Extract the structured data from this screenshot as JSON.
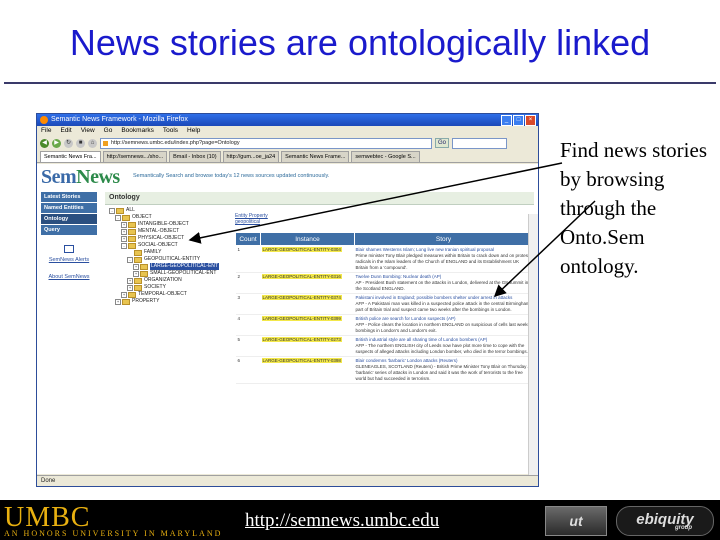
{
  "slide": {
    "title": "News stories are ontologically linked",
    "callout": "Find news stories by browsing through the Onto.Sem ontology.",
    "footer_url": "http://semnews.umbc.edu",
    "footer_logo_umbc": "UMBC",
    "footer_logo_umbc_sub": "AN HONORS UNIVERSITY IN MARYLAND",
    "footer_logo_ut": "ut",
    "footer_logo_ebiquity": "ebiquity",
    "footer_logo_ebiquity_sub": "group"
  },
  "browser": {
    "title": "Semantic News Framework - Mozilla Firefox",
    "menu": [
      "File",
      "Edit",
      "View",
      "Go",
      "Bookmarks",
      "Tools",
      "Help"
    ],
    "url": "http://semnews.umbc.edu/index.php?page=Ontology",
    "go_label": "Go",
    "search_placeholder": "",
    "tabs": [
      {
        "label": "Semantic News Fra...",
        "active": true
      },
      {
        "label": "http://semnews.../sho...",
        "active": false
      },
      {
        "label": "Bmail - Inbox (10)",
        "active": false
      },
      {
        "label": "http://gum...oe_ja24",
        "active": false
      },
      {
        "label": "Semantic News Frame...",
        "active": false
      },
      {
        "label": "semwebtec - Google S...",
        "active": false
      }
    ],
    "status": "Done"
  },
  "page": {
    "logo_prefix": "Sem",
    "logo_suffix": "News",
    "tagline": "Semantically Search and browse today's 12 news sources updated continuously.",
    "nav": [
      {
        "label": "Latest Stories",
        "selected": false
      },
      {
        "label": "Named Entities",
        "selected": false
      },
      {
        "label": "Ontology",
        "selected": true
      },
      {
        "label": "Query",
        "selected": false
      }
    ],
    "side_links": [
      "SemNews Alerts",
      "About SemNews"
    ],
    "panel_title": "Ontology",
    "tree": [
      {
        "label": "ALL",
        "indent": 0,
        "toggle": "-"
      },
      {
        "label": "OBJECT",
        "indent": 1,
        "toggle": "-"
      },
      {
        "label": "INTANGIBLE-OBJECT",
        "indent": 2,
        "toggle": "+"
      },
      {
        "label": "MENTAL-OBJECT",
        "indent": 2,
        "toggle": "+"
      },
      {
        "label": "PHYSICAL-OBJECT",
        "indent": 2,
        "toggle": "+"
      },
      {
        "label": "SOCIAL-OBJECT",
        "indent": 2,
        "toggle": "-"
      },
      {
        "label": "FAMILY",
        "indent": 3,
        "toggle": ""
      },
      {
        "label": "GEOPOLITICAL-ENTITY",
        "indent": 3,
        "toggle": "-"
      },
      {
        "label": "LARGE-GEOPOLITICAL-ENT",
        "indent": 4,
        "toggle": "+",
        "highlight": true
      },
      {
        "label": "SMALL-GEOPOLITICAL-ENT",
        "indent": 4,
        "toggle": "+"
      },
      {
        "label": "ORGANIZATION",
        "indent": 3,
        "toggle": "+"
      },
      {
        "label": "SOCIETY",
        "indent": 3,
        "toggle": "+"
      },
      {
        "label": "TEMPORAL-OBJECT",
        "indent": 2,
        "toggle": "+"
      },
      {
        "label": "PROPERTY",
        "indent": 1,
        "toggle": "+"
      }
    ],
    "results_heading": "Entity Property",
    "results_sub": "geopolitical",
    "columns": [
      "Count",
      "Instance",
      "Story"
    ],
    "rows": [
      {
        "count": "1",
        "instance": "LARGE-GEOPOLITICAL-ENTITY-0304",
        "story_title": "Blair shames Westerns Islam; Long live new Iranian spiritual proposal",
        "story_text": "Prime minister Tony Blair pledged measures within Britain to crack down and on protest radicals in the Islam leaders of the Church of ENGLAND and its Establishment UK Britain from a 'compound'."
      },
      {
        "count": "2",
        "instance": "LARGE-GEOPOLITICAL-ENTITY-0316",
        "story_title": "Twelve Dunn Bombing: Nuclear death (AP)",
        "story_text": "AP - President Bush statement on the attacks in London, delivered at the G8 summit in the Scotland ENGLAND."
      },
      {
        "count": "3",
        "instance": "LARGE-GEOPOLITICAL-ENTITY-0374",
        "story_title": "Pakistani involved in England; possible bombers shelter under arrest in attacks",
        "story_text": "AFP - A Pakistani man was killed in a suspected police attack in the central Birmingham, part of Britain trial and suspect came two weeks after the bombings in London."
      },
      {
        "count": "4",
        "instance": "LARGE-GEOPOLITICAL-ENTITY-0399",
        "story_title": "British police are search for London suspects (AP)",
        "story_text": "AFP - Police clears the location in northern ENGLAND on suspicious of cells last weeks bombings in London's and London's exit."
      },
      {
        "count": "5",
        "instance": "LARGE-GEOPOLITICAL-ENTITY-0273",
        "story_title": "British industrial style are all sharing time of London bombers (AP)",
        "story_text": "AFP - The northern ENGLISH city of Leeds now have plot more time to cope with the suspects of alleged attacks including London bomber, who died in the terror bombings."
      },
      {
        "count": "6",
        "instance": "LARGE-GEOPOLITICAL-ENTITY-0398",
        "story_title": "Blair condemns 'barbaric' London attacks (Reuters)",
        "story_text": "GLENEAGLES, SCOTLAND (Reuters) - British Prime Minister Tony Blair on Thursday a 'barbaric' series of attacks in London and said it was the work of terrorists to the free world but had succeeded in terrorism."
      }
    ]
  }
}
